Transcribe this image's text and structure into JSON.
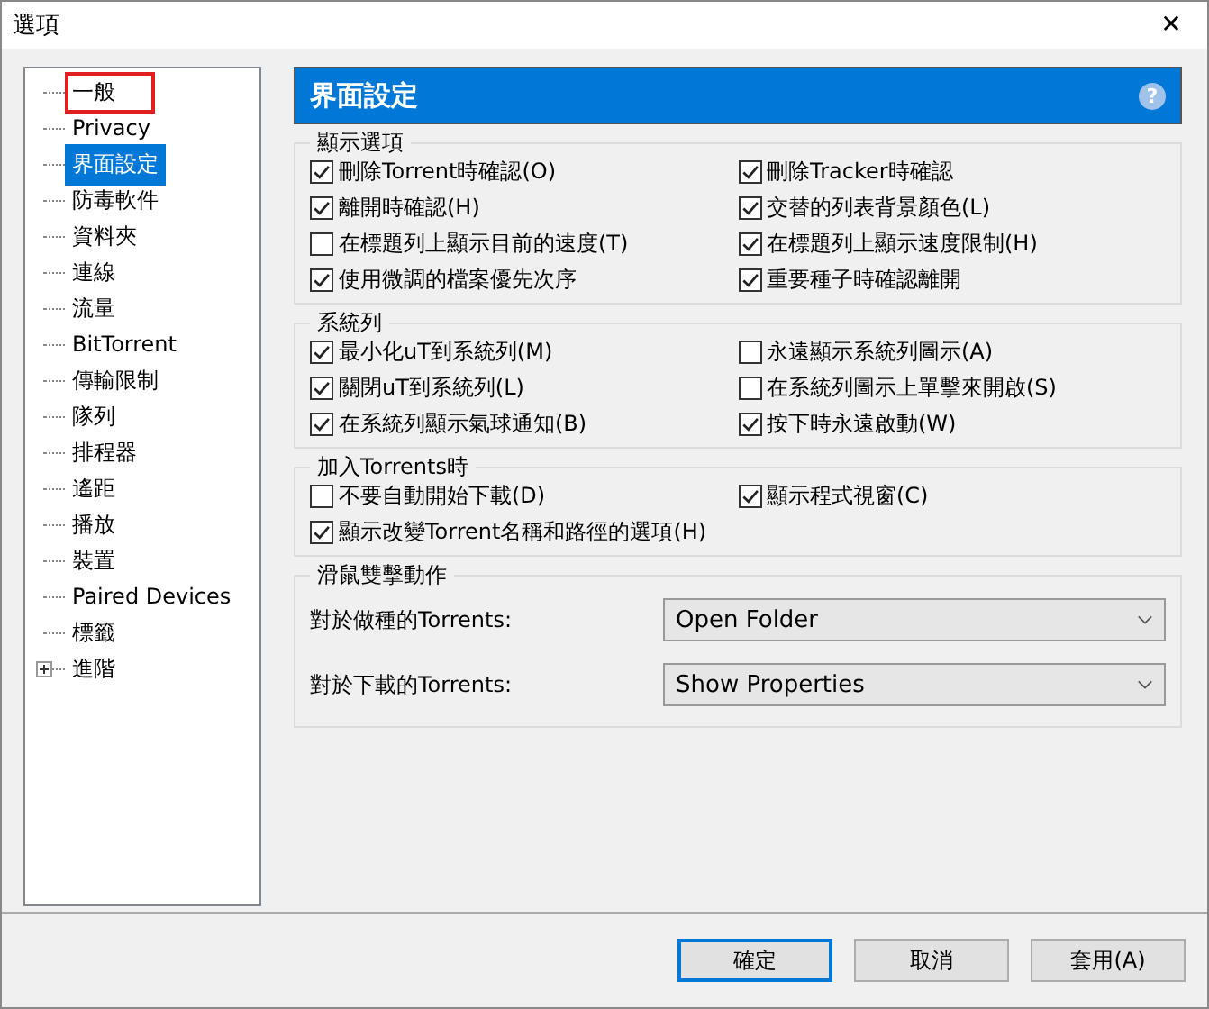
{
  "window": {
    "title": "選項",
    "close": "✕"
  },
  "tree": [
    {
      "label": "一般",
      "selected": false,
      "annotated": true
    },
    {
      "label": "Privacy",
      "selected": false,
      "annotated": false
    },
    {
      "label": "界面設定",
      "selected": true,
      "annotated": false
    },
    {
      "label": "防毒軟件",
      "selected": false,
      "annotated": false
    },
    {
      "label": "資料夾",
      "selected": false,
      "annotated": false
    },
    {
      "label": "連線",
      "selected": false,
      "annotated": false
    },
    {
      "label": "流量",
      "selected": false,
      "annotated": false
    },
    {
      "label": "BitTorrent",
      "selected": false,
      "annotated": false
    },
    {
      "label": "傳輸限制",
      "selected": false,
      "annotated": false
    },
    {
      "label": "隊列",
      "selected": false,
      "annotated": false
    },
    {
      "label": "排程器",
      "selected": false,
      "annotated": false
    },
    {
      "label": "遙距",
      "selected": false,
      "annotated": false
    },
    {
      "label": "播放",
      "selected": false,
      "annotated": false
    },
    {
      "label": "裝置",
      "selected": false,
      "annotated": false
    },
    {
      "label": "Paired Devices",
      "selected": false,
      "annotated": false
    },
    {
      "label": "標籤",
      "selected": false,
      "annotated": false
    },
    {
      "label": "進階",
      "selected": false,
      "annotated": false,
      "expanded": false
    }
  ],
  "panel": {
    "title": "界面設定",
    "help": "?"
  },
  "groups": [
    {
      "title": "顯示選項",
      "kind": "checkboxes",
      "items": [
        {
          "label": "刪除Torrent時確認(O)",
          "checked": true
        },
        {
          "label": "刪除Tracker時確認",
          "checked": true
        },
        {
          "label": "離開時確認(H)",
          "checked": true
        },
        {
          "label": "交替的列表背景顏色(L)",
          "checked": true
        },
        {
          "label": "在標題列上顯示目前的速度(T)",
          "checked": false
        },
        {
          "label": "在標題列上顯示速度限制(H)",
          "checked": true
        },
        {
          "label": "使用微調的檔案優先次序",
          "checked": true
        },
        {
          "label": "重要種子時確認離開",
          "checked": true
        }
      ]
    },
    {
      "title": "系統列",
      "kind": "checkboxes",
      "items": [
        {
          "label": "最小化uT到系統列(M)",
          "checked": true
        },
        {
          "label": "永遠顯示系統列圖示(A)",
          "checked": false
        },
        {
          "label": "關閉uT到系統列(L)",
          "checked": true
        },
        {
          "label": "在系統列圖示上單擊來開啟(S)",
          "checked": false
        },
        {
          "label": "在系統列顯示氣球通知(B)",
          "checked": true
        },
        {
          "label": "按下時永遠啟動(W)",
          "checked": true
        }
      ]
    },
    {
      "title": "加入Torrents時",
      "kind": "checkboxes",
      "items": [
        {
          "label": "不要自動開始下載(D)",
          "checked": false
        },
        {
          "label": "顯示程式視窗(C)",
          "checked": true
        },
        {
          "label": "顯示改變Torrent名稱和路徑的選項(H)",
          "checked": true
        }
      ]
    },
    {
      "title": "滑鼠雙擊動作",
      "kind": "dropdowns",
      "items": [
        {
          "label": "對於做種的Torrents:",
          "value": "Open Folder"
        },
        {
          "label": "對於下載的Torrents:",
          "value": "Show Properties"
        }
      ]
    }
  ],
  "buttons": [
    "確定",
    "取消",
    "套用(A)"
  ]
}
